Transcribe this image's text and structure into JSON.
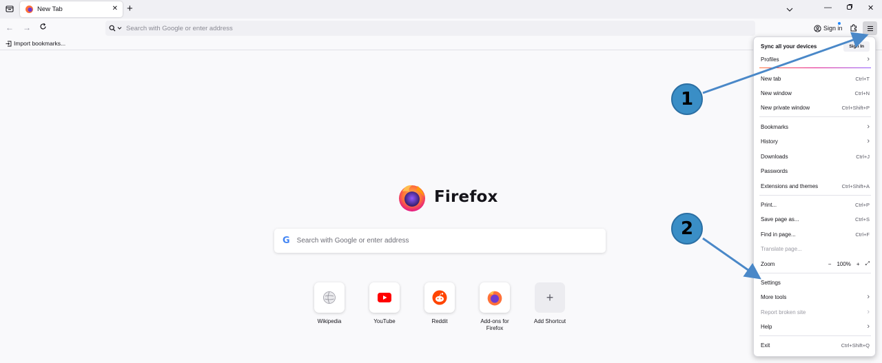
{
  "tab": {
    "title": "New Tab"
  },
  "navbar": {
    "search_placeholder": "Search with Google or enter address",
    "signin_label": "Sign in"
  },
  "bookmarks": {
    "import_label": "Import bookmarks..."
  },
  "content": {
    "brand_name": "Firefox",
    "search_placeholder": "Search with Google or enter address",
    "google_letter": "G",
    "shortcuts": [
      {
        "label": "Wikipedia",
        "icon": "wikipedia-icon"
      },
      {
        "label": "YouTube",
        "icon": "youtube-icon"
      },
      {
        "label": "Reddit",
        "icon": "reddit-icon"
      },
      {
        "label": "Add-ons for Firefox",
        "icon": "firefox-addons-icon"
      },
      {
        "label": "Add Shortcut",
        "icon": "plus-icon"
      }
    ]
  },
  "menu": {
    "sync_label": "Sync all your devices",
    "sync_button": "Sign In",
    "profiles": "Profiles",
    "new_tab": {
      "label": "New tab",
      "key": "Ctrl+T"
    },
    "new_window": {
      "label": "New window",
      "key": "Ctrl+N"
    },
    "new_private": {
      "label": "New private window",
      "key": "Ctrl+Shift+P"
    },
    "bookmarks": "Bookmarks",
    "history": "History",
    "downloads": {
      "label": "Downloads",
      "key": "Ctrl+J"
    },
    "passwords": "Passwords",
    "extensions": {
      "label": "Extensions and themes",
      "key": "Ctrl+Shift+A"
    },
    "print": {
      "label": "Print...",
      "key": "Ctrl+P"
    },
    "save_page": {
      "label": "Save page as...",
      "key": "Ctrl+S"
    },
    "find": {
      "label": "Find in page...",
      "key": "Ctrl+F"
    },
    "translate": "Translate page...",
    "zoom": {
      "label": "Zoom",
      "minus": "−",
      "value": "100%",
      "plus": "+"
    },
    "settings": "Settings",
    "more_tools": "More tools",
    "report": "Report broken site",
    "help": "Help",
    "exit": {
      "label": "Exit",
      "key": "Ctrl+Shift+Q"
    }
  },
  "callouts": {
    "one": "1",
    "two": "2"
  },
  "colors": {
    "accent": "#3a8ec6",
    "arrow": "#4a88c8",
    "firefox_orange": "#ff7139",
    "firefox_purple": "#6e3bd0"
  }
}
